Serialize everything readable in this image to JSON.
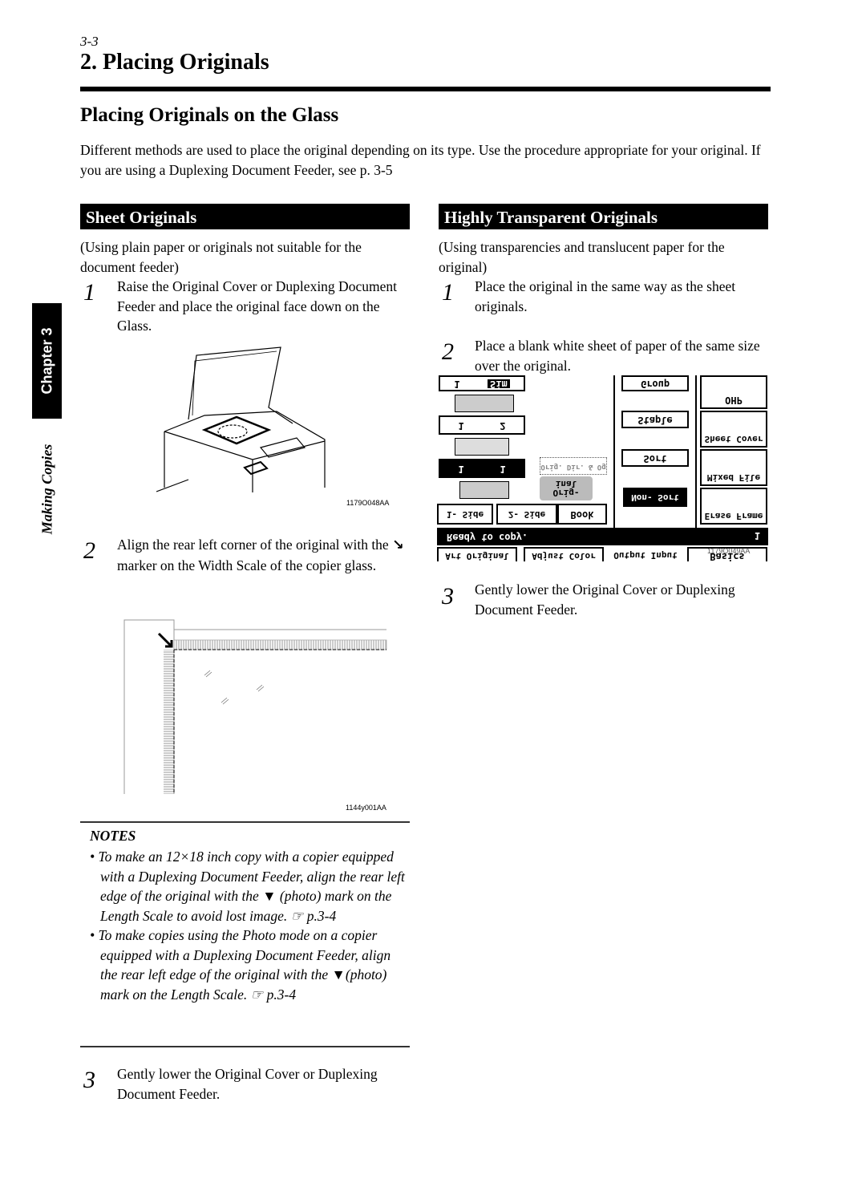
{
  "page_number": "3-3",
  "chapter_title": "2. Placing Originals",
  "section_title": "Placing Originals on the Glass",
  "intro": "Different methods are used to place the original depending on its type. Use the procedure appropriate for your original. If you are using a Duplexing Document Feeder, see p. 3-5",
  "side_tab": {
    "chapter": "Chapter 3",
    "section": "Making Copies"
  },
  "left": {
    "header": "Sheet Originals",
    "subtitle": "(Using plain paper or originals not suitable for the document feeder)",
    "steps": [
      {
        "num": "1",
        "text": "Raise the Original Cover or Duplexing Document Feeder and place the original face down on the Glass."
      },
      {
        "num": "2",
        "text_before": "Align the rear left corner of the original with the",
        "marker": "↘",
        "text_after": "marker on the Width Scale of the copier glass."
      },
      {
        "num": "3",
        "text": "Gently lower the Original Cover or Duplexing Document Feeder."
      }
    ],
    "figure1_label": "1179O048AA",
    "figure2_label": "1144y001AA",
    "notes": {
      "title": "NOTES",
      "items": [
        {
          "text": "To make an 12×18 inch copy with a copier equipped with a Duplexing Document Feeder, align the rear left edge of the original with the ▼ (photo) mark on the Length Scale to avoid lost image.",
          "ref": "☞ p.3-4"
        },
        {
          "text": "To make copies using the Photo mode on a copier equipped with a Duplexing Document Feeder, align the rear left edge of the original with the ▼(photo) mark on the Length Scale.",
          "ref": "☞ p.3-4"
        }
      ]
    }
  },
  "right": {
    "header": "Highly Transparent Originals",
    "subtitle": "(Using transparencies and translucent paper for the original)",
    "steps": [
      {
        "num": "1",
        "text": "Place the original in the same way as the sheet originals."
      },
      {
        "num": "2",
        "text": "Place a blank white sheet of paper of the same size over the original."
      },
      {
        "num": "3",
        "text": "Gently lower the Original Cover or Duplexing Document Feeder."
      }
    ],
    "figure_label": "1179O049AA",
    "panel": {
      "rows": [
        [
          "1",
          "Sim"
        ],
        [
          "1",
          "2"
        ],
        [
          "1",
          "1"
        ]
      ],
      "orig_label": "Orig- inal",
      "orig_dotted": "Orig. Dir. & Og",
      "tabs": [
        "1- Side",
        "2- Side",
        "Book"
      ],
      "finish": [
        "Group",
        "Staple",
        "Sort",
        "Non- Sort"
      ],
      "special": [
        "OHP",
        "Sheet Cover",
        "Mixed File",
        "Erase Frame"
      ],
      "status": "Ready to copy.",
      "count": "1",
      "bottom_tabs": [
        "Art Original",
        "Adjust Color",
        "Output Input",
        "Basics"
      ]
    }
  }
}
